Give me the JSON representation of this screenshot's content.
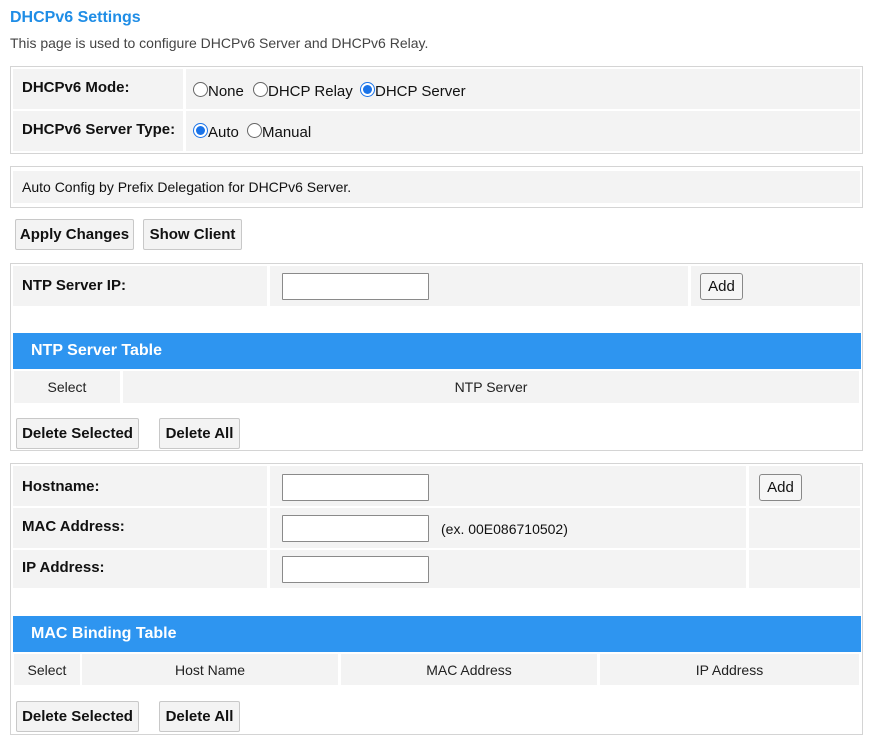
{
  "page": {
    "title": "DHCPv6 Settings",
    "description": "This page is used to configure DHCPv6 Server and DHCPv6 Relay."
  },
  "mode": {
    "label": "DHCPv6 Mode:",
    "options": [
      "None",
      "DHCP Relay",
      "DHCP Server"
    ],
    "selected": "DHCP Server"
  },
  "server_type": {
    "label": "DHCPv6 Server Type:",
    "options": [
      "Auto",
      "Manual"
    ],
    "selected": "Auto"
  },
  "info": {
    "text": "Auto Config by Prefix Delegation for DHCPv6 Server."
  },
  "actions": {
    "apply_label": "Apply Changes",
    "show_client_label": "Show Client"
  },
  "ntp": {
    "label": "NTP Server IP:",
    "value": "",
    "add_label": "Add",
    "table_title": "NTP Server Table",
    "columns": [
      "Select",
      "NTP Server"
    ],
    "delete_selected_label": "Delete Selected",
    "delete_all_label": "Delete All"
  },
  "binding": {
    "hostname_label": "Hostname:",
    "hostname_value": "",
    "add_label": "Add",
    "mac_label": "MAC Address:",
    "mac_value": "",
    "mac_hint": "(ex. 00E086710502)",
    "ip_label": "IP Address:",
    "ip_value": "",
    "table_title": "MAC Binding Table",
    "columns": [
      "Select",
      "Host Name",
      "MAC Address",
      "IP Address"
    ],
    "delete_selected_label": "Delete Selected",
    "delete_all_label": "Delete All"
  }
}
